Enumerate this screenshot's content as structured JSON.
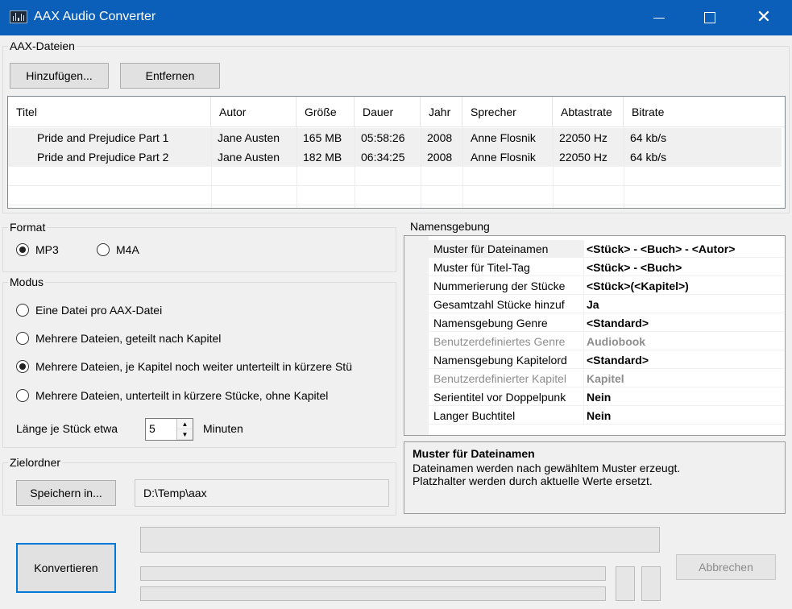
{
  "window": {
    "title": "AAX Audio Converter"
  },
  "aax_files": {
    "legend": "AAX-Dateien",
    "add_button": "Hinzufügen...",
    "remove_button": "Entfernen",
    "columns": [
      "Titel",
      "Autor",
      "Größe",
      "Dauer",
      "Jahr",
      "Sprecher",
      "Abtastrate",
      "Bitrate"
    ],
    "rows": [
      [
        "Pride and Prejudice Part 1",
        "Jane Austen",
        "165 MB",
        "05:58:26",
        "2008",
        "Anne Flosnik",
        "22050 Hz",
        "64 kb/s"
      ],
      [
        "Pride and Prejudice Part 2",
        "Jane Austen",
        "182 MB",
        "06:34:25",
        "2008",
        "Anne Flosnik",
        "22050 Hz",
        "64 kb/s"
      ]
    ]
  },
  "format": {
    "legend": "Format",
    "options": [
      {
        "label": "MP3",
        "checked": true
      },
      {
        "label": "M4A",
        "checked": false
      }
    ]
  },
  "mode": {
    "legend": "Modus",
    "options": [
      {
        "label": "Eine Datei pro AAX-Datei",
        "checked": false
      },
      {
        "label": "Mehrere Dateien, geteilt nach Kapitel",
        "checked": false
      },
      {
        "label": "Mehrere Dateien, je Kapitel noch weiter unterteilt in kürzere Stü",
        "checked": true
      },
      {
        "label": "Mehrere Dateien, unterteilt in kürzere Stücke, ohne Kapitel",
        "checked": false
      }
    ],
    "length_label": "Länge je Stück etwa",
    "length_value": "5",
    "length_unit": "Minuten"
  },
  "target": {
    "legend": "Zielordner",
    "save_button": "Speichern in...",
    "path": "D:\\Temp\\aax"
  },
  "naming": {
    "legend": "Namensgebung",
    "properties": [
      {
        "name": "Muster für Dateinamen",
        "value": "<Stück> - <Buch> - <Autor>",
        "disabled": false
      },
      {
        "name": "Muster für Titel-Tag",
        "value": "<Stück> - <Buch>",
        "disabled": false
      },
      {
        "name": "Nummerierung der Stücke",
        "value": "<Stück>(<Kapitel>)",
        "disabled": false
      },
      {
        "name": "Gesamtzahl Stücke hinzuf",
        "value": "Ja",
        "disabled": false
      },
      {
        "name": "Namensgebung Genre",
        "value": "<Standard>",
        "disabled": false
      },
      {
        "name": "Benutzerdefiniertes Genre",
        "value": "Audiobook",
        "disabled": true
      },
      {
        "name": "Namensgebung Kapitelord",
        "value": "<Standard>",
        "disabled": false
      },
      {
        "name": "Benutzerdefinierter Kapitel",
        "value": "Kapitel",
        "disabled": true
      },
      {
        "name": "Serientitel vor Doppelpunk",
        "value": "Nein",
        "disabled": false
      },
      {
        "name": "Langer Buchtitel",
        "value": "Nein",
        "disabled": false
      }
    ],
    "description_title": "Muster für Dateinamen",
    "description_line1": "Dateinamen werden nach gewähltem Muster erzeugt.",
    "description_line2": "Platzhalter werden durch aktuelle Werte ersetzt."
  },
  "actions": {
    "convert_button": "Konvertieren",
    "cancel_button": "Abbrechen"
  }
}
